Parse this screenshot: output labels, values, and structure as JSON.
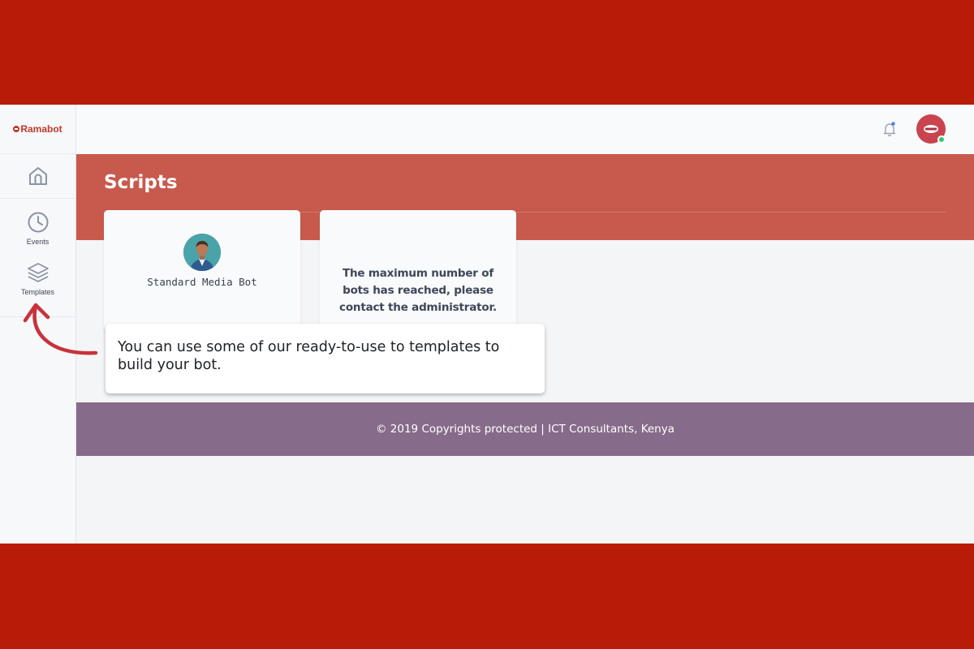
{
  "brand": {
    "name": "Ramabot"
  },
  "sidebar": {
    "items": [
      {
        "label": "",
        "icon": "home-icon"
      },
      {
        "label": "Events",
        "icon": "clock-icon"
      },
      {
        "label": "Templates",
        "icon": "layers-icon"
      }
    ]
  },
  "topbar": {
    "notification_icon": "bell-icon",
    "avatar_icon": "user-avatar"
  },
  "header": {
    "title": "Scripts"
  },
  "cards": [
    {
      "name": "Standard Media Bot",
      "icon": "bot-avatar"
    },
    {
      "message": "The maximum number of bots has reached, please contact the administrator."
    }
  ],
  "tooltip": {
    "text": "You can use some of our ready-to-use to templates to build your bot."
  },
  "footer": {
    "text": "© 2019 Copyrights protected | ICT Consultants, Kenya"
  },
  "colors": {
    "outer_background": "#b81b08",
    "header_band": "#c75a4d",
    "footer": "#876b8a",
    "brand": "#c0392b",
    "status_online": "#2ecc71",
    "annotation_arrow": "#c8323a"
  }
}
